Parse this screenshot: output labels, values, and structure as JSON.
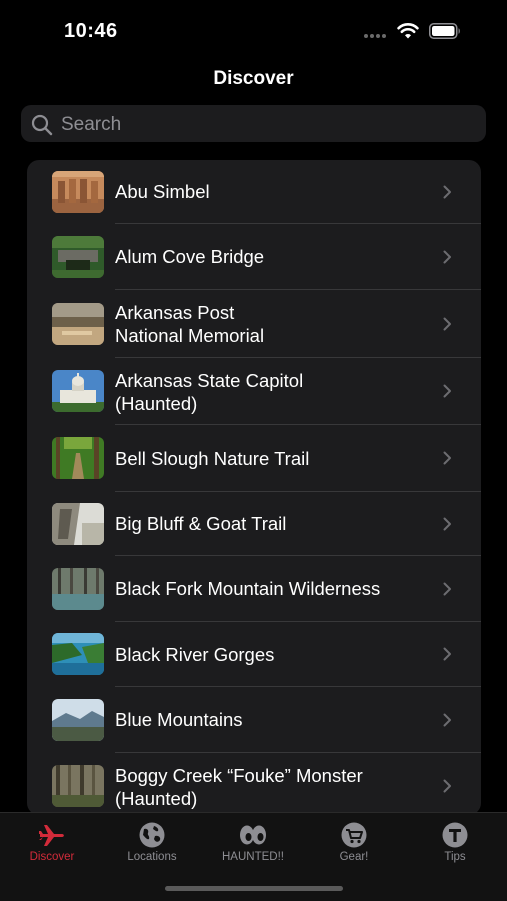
{
  "status_bar": {
    "time": "10:46"
  },
  "nav": {
    "title": "Discover"
  },
  "search": {
    "placeholder": "Search"
  },
  "list": {
    "items": [
      {
        "label": "Abu Simbel",
        "thumb_icon": "temple-photo-thumbnail"
      },
      {
        "label": "Alum Cove Bridge",
        "thumb_icon": "rock-arch-photo-thumbnail"
      },
      {
        "label": "Arkansas Post\nNational Memorial",
        "thumb_icon": "river-photo-thumbnail"
      },
      {
        "label": "Arkansas State Capitol\n(Haunted)",
        "thumb_icon": "capitol-photo-thumbnail"
      },
      {
        "label": "Bell Slough Nature Trail",
        "thumb_icon": "forest-trail-photo-thumbnail"
      },
      {
        "label": "Big Bluff & Goat Trail",
        "thumb_icon": "bluff-photo-thumbnail"
      },
      {
        "label": "Black Fork Mountain Wilderness",
        "thumb_icon": "woods-photo-thumbnail"
      },
      {
        "label": "Black River Gorges",
        "thumb_icon": "gorge-photo-thumbnail"
      },
      {
        "label": "Blue Mountains",
        "thumb_icon": "mountain-photo-thumbnail"
      },
      {
        "label": "Boggy Creek “Fouke” Monster\n(Haunted)",
        "thumb_icon": "swamp-photo-thumbnail"
      }
    ]
  },
  "tabs": [
    {
      "label": "Discover",
      "icon": "airplane-icon",
      "active": true
    },
    {
      "label": "Locations",
      "icon": "globe-icon",
      "active": false
    },
    {
      "label": "HAUNTED!!",
      "icon": "eyes-icon",
      "active": false
    },
    {
      "label": "Gear!",
      "icon": "cart-icon",
      "active": false
    },
    {
      "label": "Tips",
      "icon": "letter-t-icon",
      "active": false
    }
  ],
  "colors": {
    "background": "#000000",
    "list_background": "#1c1c1e",
    "accent_active_tab": "#d22b3a",
    "inactive_tab": "#8e8e93"
  }
}
